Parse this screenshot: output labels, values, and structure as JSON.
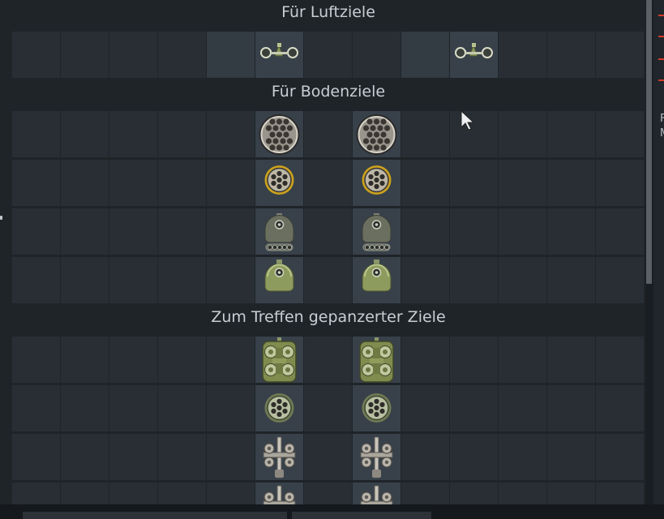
{
  "sections": {
    "air": {
      "title": "Für Luftziele"
    },
    "ground": {
      "title": "Für Bodenziele"
    },
    "armored": {
      "title": "Zum Treffen gepanzerter Ziele"
    }
  },
  "grid_columns": 13,
  "air_row": {
    "weapons": [
      {
        "column": 5,
        "icon": "twin-gun-pod-icon"
      },
      {
        "column": 9,
        "icon": "twin-gun-pod-icon"
      }
    ]
  },
  "ground_rows": [
    {
      "icon": "rocket-pod-large-icon",
      "columns": [
        6,
        8
      ]
    },
    {
      "icon": "rocket-pod-small-yellow-icon",
      "columns": [
        6,
        8
      ]
    },
    {
      "icon": "bomb-with-rack-icon",
      "columns": [
        6,
        8
      ]
    },
    {
      "icon": "bomb-green-icon",
      "columns": [
        6,
        8
      ]
    }
  ],
  "armored_rows": [
    {
      "icon": "atgm-launcher-icon",
      "columns": [
        6,
        8
      ]
    },
    {
      "icon": "rocket-pod-green-icon",
      "columns": [
        6,
        8
      ]
    },
    {
      "icon": "missile-rack-icon",
      "columns": [
        6,
        8
      ]
    },
    {
      "icon": "missile-rack-icon",
      "columns": [
        6,
        8
      ]
    }
  ],
  "colors": {
    "cell": "#282e34",
    "cell_highlight": "#333b43",
    "header_text": "#c9ced3",
    "accent_red": "#d23b2b"
  },
  "right_panel": {
    "lines": [
      "F",
      "M"
    ]
  }
}
